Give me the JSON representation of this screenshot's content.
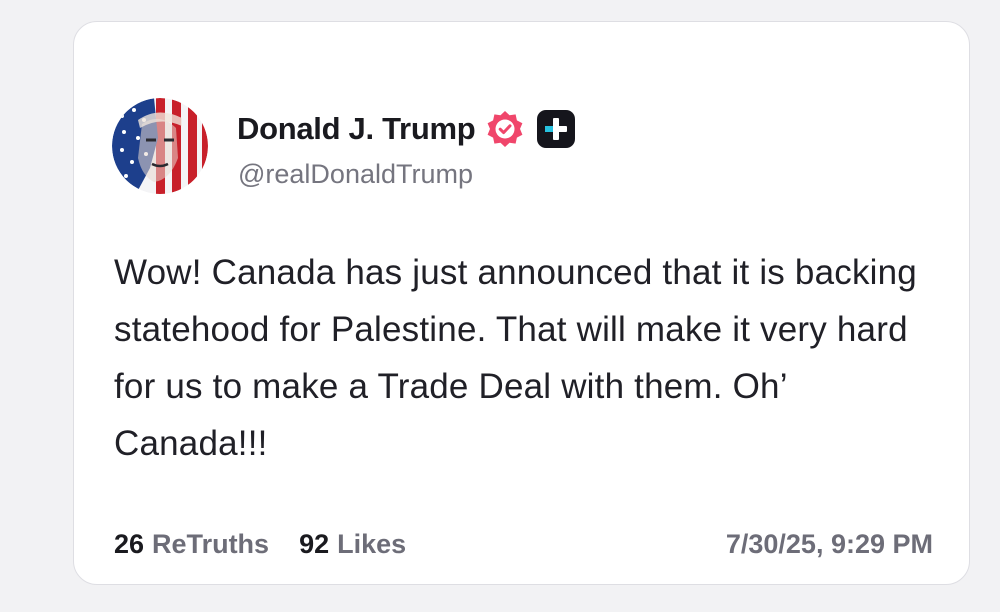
{
  "post": {
    "author": {
      "display_name": "Donald J. Trump",
      "handle": "@realDonaldTrump",
      "avatar": "stars-and-stripes-portrait-avatar",
      "verified_icon": "verified-badge-icon",
      "plus_icon": "truth-plus-icon"
    },
    "text": "Wow! Canada has just announced that it is backing statehood for Palestine. That will make it very hard for us to make a Trade Deal with them. Oh’ Canada!!!",
    "stats": {
      "retruths_count": "26",
      "retruths_label": "ReTruths",
      "likes_count": "92",
      "likes_label": "Likes"
    },
    "timestamp": "7/30/25, 9:29 PM"
  },
  "colors": {
    "verified_badge": "#f0466b",
    "plus_badge": "#15151c",
    "text_primary": "#1a1a1f",
    "text_secondary": "#75757f"
  }
}
